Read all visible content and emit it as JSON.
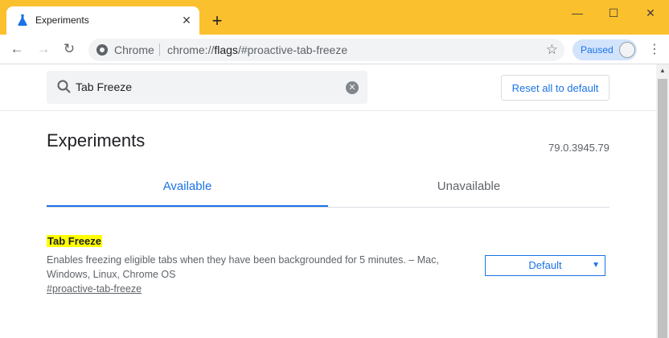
{
  "browser": {
    "tab_title": "Experiments",
    "tab_close": "✕",
    "new_tab": "+",
    "window_controls": {
      "minimize": "—",
      "maximize": "☐",
      "close": "✕"
    }
  },
  "toolbar": {
    "back": "←",
    "forward": "→",
    "reload": "↻",
    "chip_label": "Chrome",
    "url_prefix": "chrome://",
    "url_host": "flags",
    "url_path": "/#proactive-tab-freeze",
    "star": "☆",
    "profile_label": "Paused",
    "menu": "⋮"
  },
  "flags_header": {
    "search_value": "Tab Freeze",
    "clear_label": "✕",
    "reset_label": "Reset all to default"
  },
  "main": {
    "title": "Experiments",
    "version": "79.0.3945.79",
    "tabs": [
      {
        "label": "Available",
        "active": true
      },
      {
        "label": "Unavailable",
        "active": false
      }
    ],
    "experiment": {
      "name": "Tab Freeze",
      "description": "Enables freezing eligible tabs when they have been backgrounded for 5 minutes. – Mac, Windows, Linux, Chrome OS",
      "link": "#proactive-tab-freeze",
      "selected_option": "Default",
      "caret": "▼"
    }
  },
  "colors": {
    "titlebar": "#fbc02d",
    "accent": "#1a73e8",
    "highlight": "#ffff00"
  },
  "icons": [
    "flask-icon",
    "close-icon",
    "plus-icon",
    "back-arrow-icon",
    "forward-arrow-icon",
    "reload-icon",
    "site-info-icon",
    "star-icon",
    "avatar-icon",
    "more-menu-icon",
    "search-icon",
    "clear-icon",
    "dropdown-caret-icon"
  ]
}
